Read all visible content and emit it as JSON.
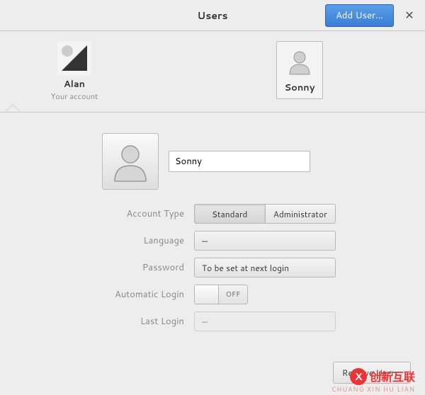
{
  "header": {
    "title": "Users",
    "add_user_label": "Add User...",
    "close_symbol": "✕"
  },
  "user_list": [
    {
      "name": "Alan",
      "subtitle": "Your account",
      "avatar_kind": "photo",
      "selected": false
    },
    {
      "name": "Sonny",
      "subtitle": "",
      "avatar_kind": "generic",
      "selected": true
    }
  ],
  "detail": {
    "name_value": "Sonny",
    "labels": {
      "account_type": "Account Type",
      "language": "Language",
      "password": "Password",
      "automatic_login": "Automatic Login",
      "last_login": "Last Login"
    },
    "account_type_options": {
      "standard": "Standard",
      "administrator": "Administrator"
    },
    "account_type_selected": "standard",
    "language_value": "—",
    "password_value": "To be set at next login",
    "automatic_login_state": "OFF",
    "last_login_value": "—"
  },
  "footer": {
    "remove_user_label": "Remove User..."
  },
  "watermark": {
    "badge": "X",
    "text": "创新互联",
    "sub": "CHUANG XIN HU LIAN"
  }
}
